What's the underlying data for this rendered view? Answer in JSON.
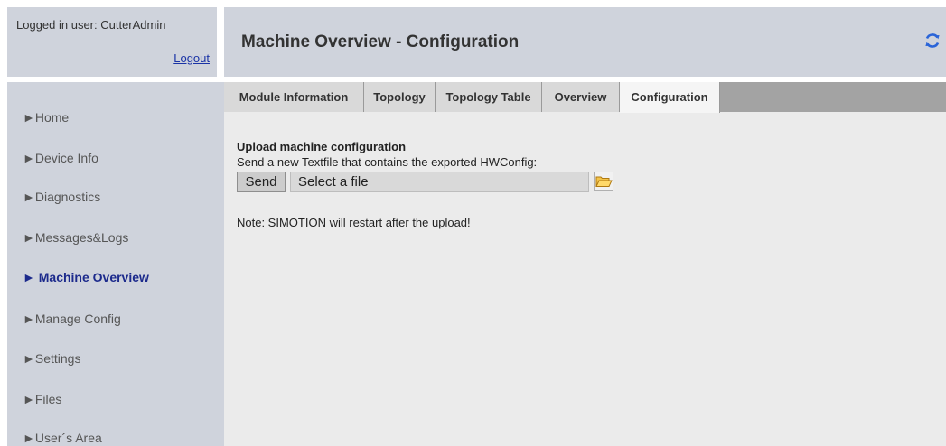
{
  "login": {
    "user_text": "Logged in user: CutterAdmin",
    "logout_label": "Logout"
  },
  "header": {
    "title": "Machine Overview - Configuration",
    "refresh_icon": "refresh-icon"
  },
  "sidebar": {
    "items": [
      {
        "label": "►Home"
      },
      {
        "label": "►Device Info"
      },
      {
        "label": "►Diagnostics"
      },
      {
        "label": "►Messages&Logs"
      },
      {
        "label": "► Machine Overview",
        "active": true
      },
      {
        "label": "►Manage Config"
      },
      {
        "label": "►Settings"
      },
      {
        "label": "►Files"
      },
      {
        "label": "►User´s Area"
      }
    ]
  },
  "tabs": [
    {
      "label": "Module Information"
    },
    {
      "label": "Topology"
    },
    {
      "label": "Topology Table"
    },
    {
      "label": "Overview"
    },
    {
      "label": "Configuration",
      "active": true
    }
  ],
  "upload": {
    "title": "Upload machine configuration",
    "description": "Send a new Textfile that contains the exported HWConfig:",
    "send_label": "Send",
    "file_placeholder": "Select a file",
    "folder_icon": "folder-open-icon",
    "note": "Note: SIMOTION will restart after the upload!"
  },
  "colors": {
    "panel_bg": "#cfd3dc",
    "content_bg": "#ebebeb",
    "active_nav": "#1c2a8c",
    "link": "#1a33a6"
  }
}
